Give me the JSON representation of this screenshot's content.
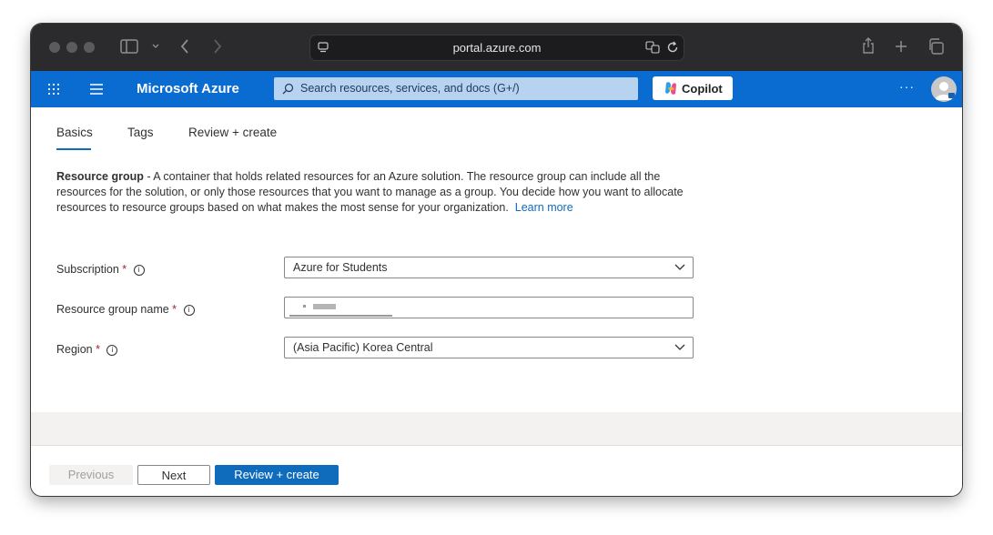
{
  "browser": {
    "url": "portal.azure.com"
  },
  "azure": {
    "brand": "Microsoft Azure",
    "search_placeholder": "Search resources, services, and docs (G+/)",
    "copilot_label": "Copilot",
    "more_label": "···"
  },
  "tabs": [
    {
      "label": "Basics",
      "active": true
    },
    {
      "label": "Tags",
      "active": false
    },
    {
      "label": "Review + create",
      "active": false
    }
  ],
  "description": {
    "term": "Resource group",
    "text": " - A container that holds related resources for an Azure solution. The resource group can include all the resources for the solution, or only those resources that you want to manage as a group. You decide how you want to allocate resources to resource groups based on what makes the most sense for your organization.",
    "link": "Learn more"
  },
  "form": {
    "subscription": {
      "label": "Subscription",
      "required_mark": "*",
      "value": "Azure for Students"
    },
    "resource_group_name": {
      "label": "Resource group name",
      "required_mark": "*",
      "value": ""
    },
    "region": {
      "label": "Region",
      "required_mark": "*",
      "value": "(Asia Pacific) Korea Central"
    }
  },
  "footer": {
    "previous_label": "Previous",
    "next_label": "Next",
    "review_label": "Review + create"
  },
  "colors": {
    "azure_blue": "#0a6cd0",
    "primary_button": "#0f6cbd",
    "link": "#0f6cbd",
    "required": "#a4262c"
  }
}
